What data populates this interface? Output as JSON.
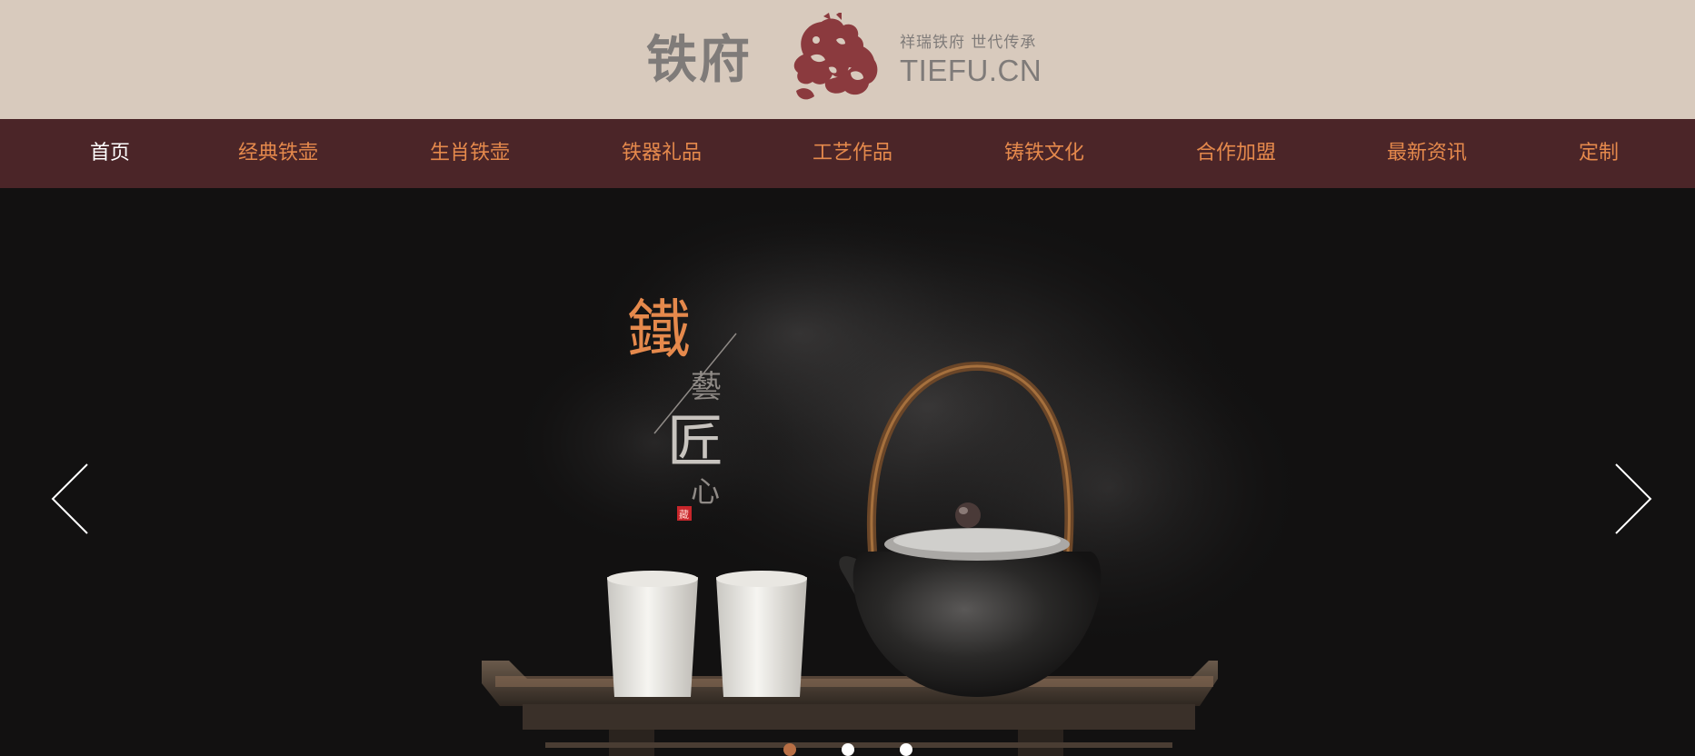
{
  "header": {
    "logo_cn": "铁府",
    "slogan": "祥瑞铁府 世代传承",
    "logo_en": "TIEFU.CN"
  },
  "nav": {
    "items": [
      {
        "label": "首页",
        "active": true
      },
      {
        "label": "经典铁壶",
        "active": false
      },
      {
        "label": "生肖铁壶",
        "active": false
      },
      {
        "label": "铁器礼品",
        "active": false
      },
      {
        "label": "工艺作品",
        "active": false
      },
      {
        "label": "铸铁文化",
        "active": false
      },
      {
        "label": "合作加盟",
        "active": false
      },
      {
        "label": "最新资讯",
        "active": false
      },
      {
        "label": "定制",
        "active": false
      }
    ]
  },
  "banner": {
    "calligraphy": {
      "char1": "鐵",
      "char2": "藝",
      "char3": "匠",
      "char4": "心",
      "seal": "藏"
    },
    "slides": 3,
    "active_slide": 1
  },
  "colors": {
    "header_bg": "#d8cabd",
    "nav_bg": "#4b2528",
    "nav_text": "#e5894c",
    "nav_active": "#ffffff",
    "logo_red": "#8b3a3e",
    "banner_bg": "#121111",
    "dot_active": "#b86f45"
  }
}
